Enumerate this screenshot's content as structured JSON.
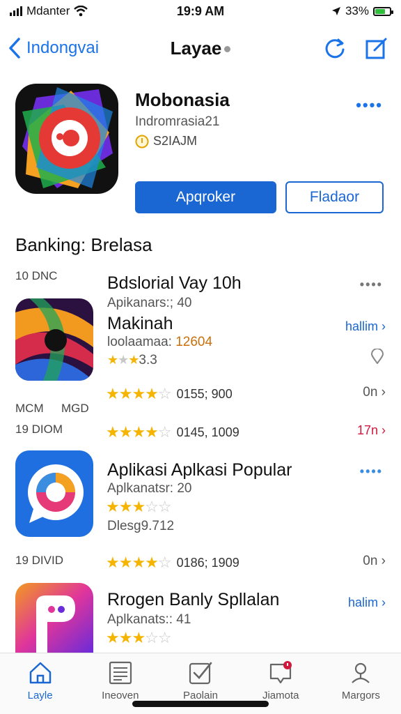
{
  "status": {
    "carrier": "Mdanter",
    "time": "19:9 AM",
    "battery": "33%"
  },
  "nav": {
    "back_label": "Indongvai",
    "title": "Layae"
  },
  "featured": {
    "name": "Mobonasia",
    "subtitle": "Indromrasia21",
    "meta": "S2IAJM",
    "primary_button": "Apqroker",
    "secondary_button": "Fladaor",
    "menu_icon": "more-dots"
  },
  "section_title": "Banking: Brelasa",
  "labels": {
    "l1": "10 DNC",
    "l2a": "MCM",
    "l2b": "MGD",
    "l3": "19 DIOM",
    "l4": "19 DIVID"
  },
  "apps": [
    {
      "title": "Bdslorial Vay 10h",
      "sub": "Apikanars:; 40",
      "title2": "Makinah",
      "sub2a": "loolaamaa: ",
      "sub2b": "12604",
      "stars_text": "3.3",
      "rating_a": "0155; 900",
      "rating_b": "0145, 1009",
      "link": "hallim",
      "r1": "0n",
      "r2": "17n"
    },
    {
      "title": "Aplikasi Aplkasi Popular",
      "sub": "Aplkanatsr: 20",
      "sub2": "Dlesg9.712",
      "rating": "0186; 1909",
      "r": "0n"
    },
    {
      "title": "Rrogen Banly Spllalan",
      "sub": "Aplkanats:: 41",
      "link": "halim"
    }
  ],
  "tabs": [
    {
      "label": "Layle",
      "icon": "home-icon"
    },
    {
      "label": "Ineoven",
      "icon": "list-icon"
    },
    {
      "label": "Paolain",
      "icon": "check-icon"
    },
    {
      "label": "Jiamota",
      "icon": "inbox-icon"
    },
    {
      "label": "Margors",
      "icon": "person-icon"
    }
  ],
  "colors": {
    "accent": "#1a66d2",
    "star": "#f4b400",
    "alert": "#d0193c"
  }
}
